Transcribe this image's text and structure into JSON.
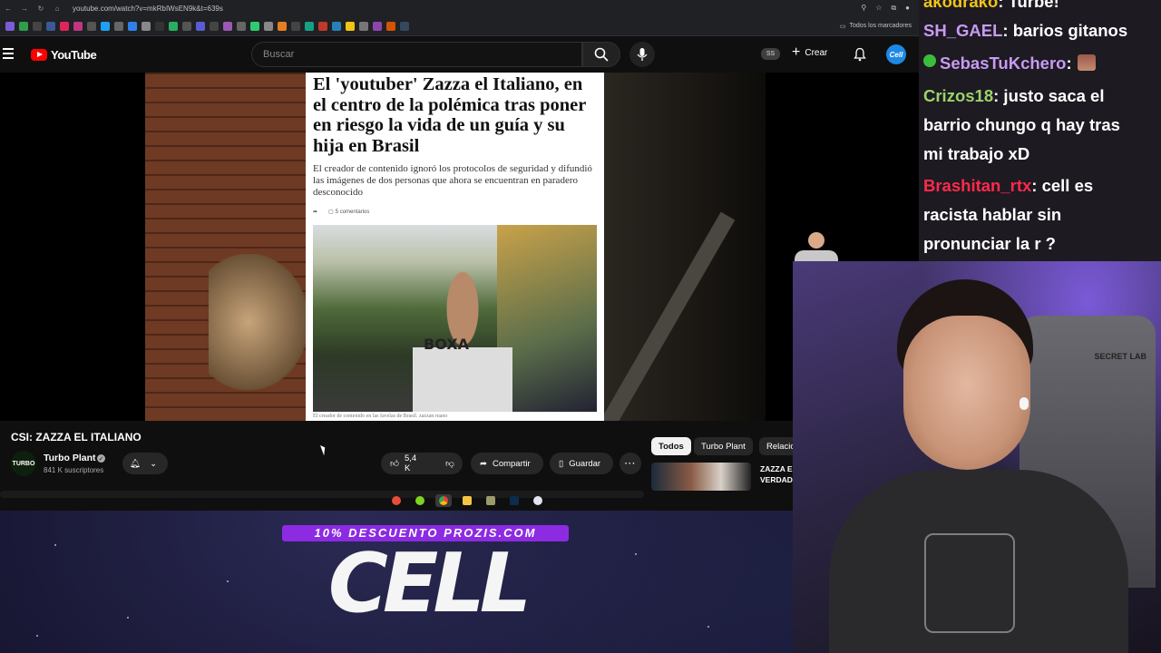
{
  "browser": {
    "url": "youtube.com/watch?v=mkRbIWsEN9k&t=639s",
    "bookmarks_folder": "Todos los marcadores"
  },
  "masthead": {
    "logo_text": "YouTube",
    "search_placeholder": "Buscar",
    "ss_badge": "SS",
    "create_label": "Crear",
    "avatar_text": "Cell"
  },
  "player": {
    "article": {
      "headline": "El 'youtuber' Zazza el Italiano, en el centro de la polémica tras poner en riesgo la vida de un guía y su hija en Brasil",
      "subheadline": "El creador de contenido ignoró los protocolos de seguridad y difundió las imágenes de dos personas que ahora se encuentran en paradero desconocido",
      "comments": "5 comentarios",
      "shirt_text": "BOXA",
      "caption": "El creador de contenido en las favelas de Brasil. zazzan ruano"
    },
    "overlay_badge": "x2"
  },
  "video": {
    "title": "CSI: ZAZZA EL ITALIANO",
    "channel_avatar": "TURBO",
    "channel_name": "Turbo Plant",
    "subscribers": "841 K suscriptores",
    "likes": "5,4 K",
    "share_label": "Compartir",
    "save_label": "Guardar"
  },
  "chips": [
    "Todos",
    "Turbo Plant",
    "Relacio"
  ],
  "recommendation": {
    "title_line1": "ZAZZA E",
    "title_line2": "VERDAD"
  },
  "chat": [
    {
      "user": "akodrako",
      "color": "#f0c419",
      "text": ": Turbe!"
    },
    {
      "user": "SH_GAEL",
      "color": "#c79bf2",
      "text": ": barios gitanos"
    },
    {
      "user": "SebasTuKchero",
      "color": "#c79bf2",
      "text": ":",
      "badge": true,
      "emote": true
    },
    {
      "user": "Crizos18",
      "color": "#9ad36a",
      "text": ": justo saca el"
    },
    {
      "user": "",
      "color": "#ffffff",
      "text": "barrio chungo q hay tras"
    },
    {
      "user": "",
      "color": "#ffffff",
      "text": "mi trabajo xD"
    },
    {
      "user": "Brashitan_rtx",
      "color": "#ff2a4a",
      "text": ": cell es"
    },
    {
      "user": "",
      "color": "#ffffff",
      "text": "racista hablar sin"
    },
    {
      "user": "",
      "color": "#ffffff",
      "text": "pronunciar la r ?"
    }
  ],
  "webcam": {
    "chair_brand": "SECRET LAB"
  },
  "sponsor": {
    "promo": "10% DESCUENTO PROZIS.COM",
    "logo": "CELL"
  },
  "colors": {
    "youtube_red": "#ff0000",
    "promo_purple": "#8c2be2",
    "chip_active": "#f1f1f1"
  }
}
